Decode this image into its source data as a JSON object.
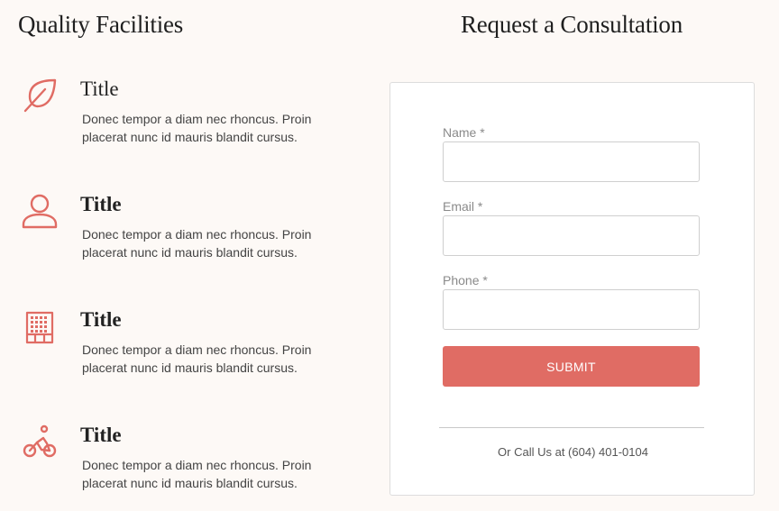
{
  "left_section": {
    "title": "Quality Facilities",
    "features": [
      {
        "icon": "leaf-icon",
        "title": "Title",
        "description": "Donec tempor a diam nec rhoncus. Proin placerat nunc id mauris blandit cursus."
      },
      {
        "icon": "user-icon",
        "title": "Title",
        "description": "Donec tempor a diam nec rhoncus. Proin placerat nunc id mauris blandit cursus."
      },
      {
        "icon": "building-icon",
        "title": "Title",
        "description": "Donec tempor a diam nec rhoncus. Proin placerat nunc id mauris blandit cursus."
      },
      {
        "icon": "bicycle-icon",
        "title": "Title",
        "description": "Donec tempor a diam nec rhoncus. Proin placerat nunc id mauris blandit cursus."
      }
    ]
  },
  "right_section": {
    "title": "Request a Consultation",
    "form": {
      "name_label": "Name *",
      "name_value": "",
      "email_label": "Email *",
      "email_value": "",
      "phone_label": "Phone *",
      "phone_value": "",
      "submit_label": "SUBMIT"
    },
    "call_text": "Or Call Us at (604) 401-0104"
  },
  "colors": {
    "accent": "#e06c64",
    "background": "#fdf9f6",
    "card": "#ffffff"
  }
}
